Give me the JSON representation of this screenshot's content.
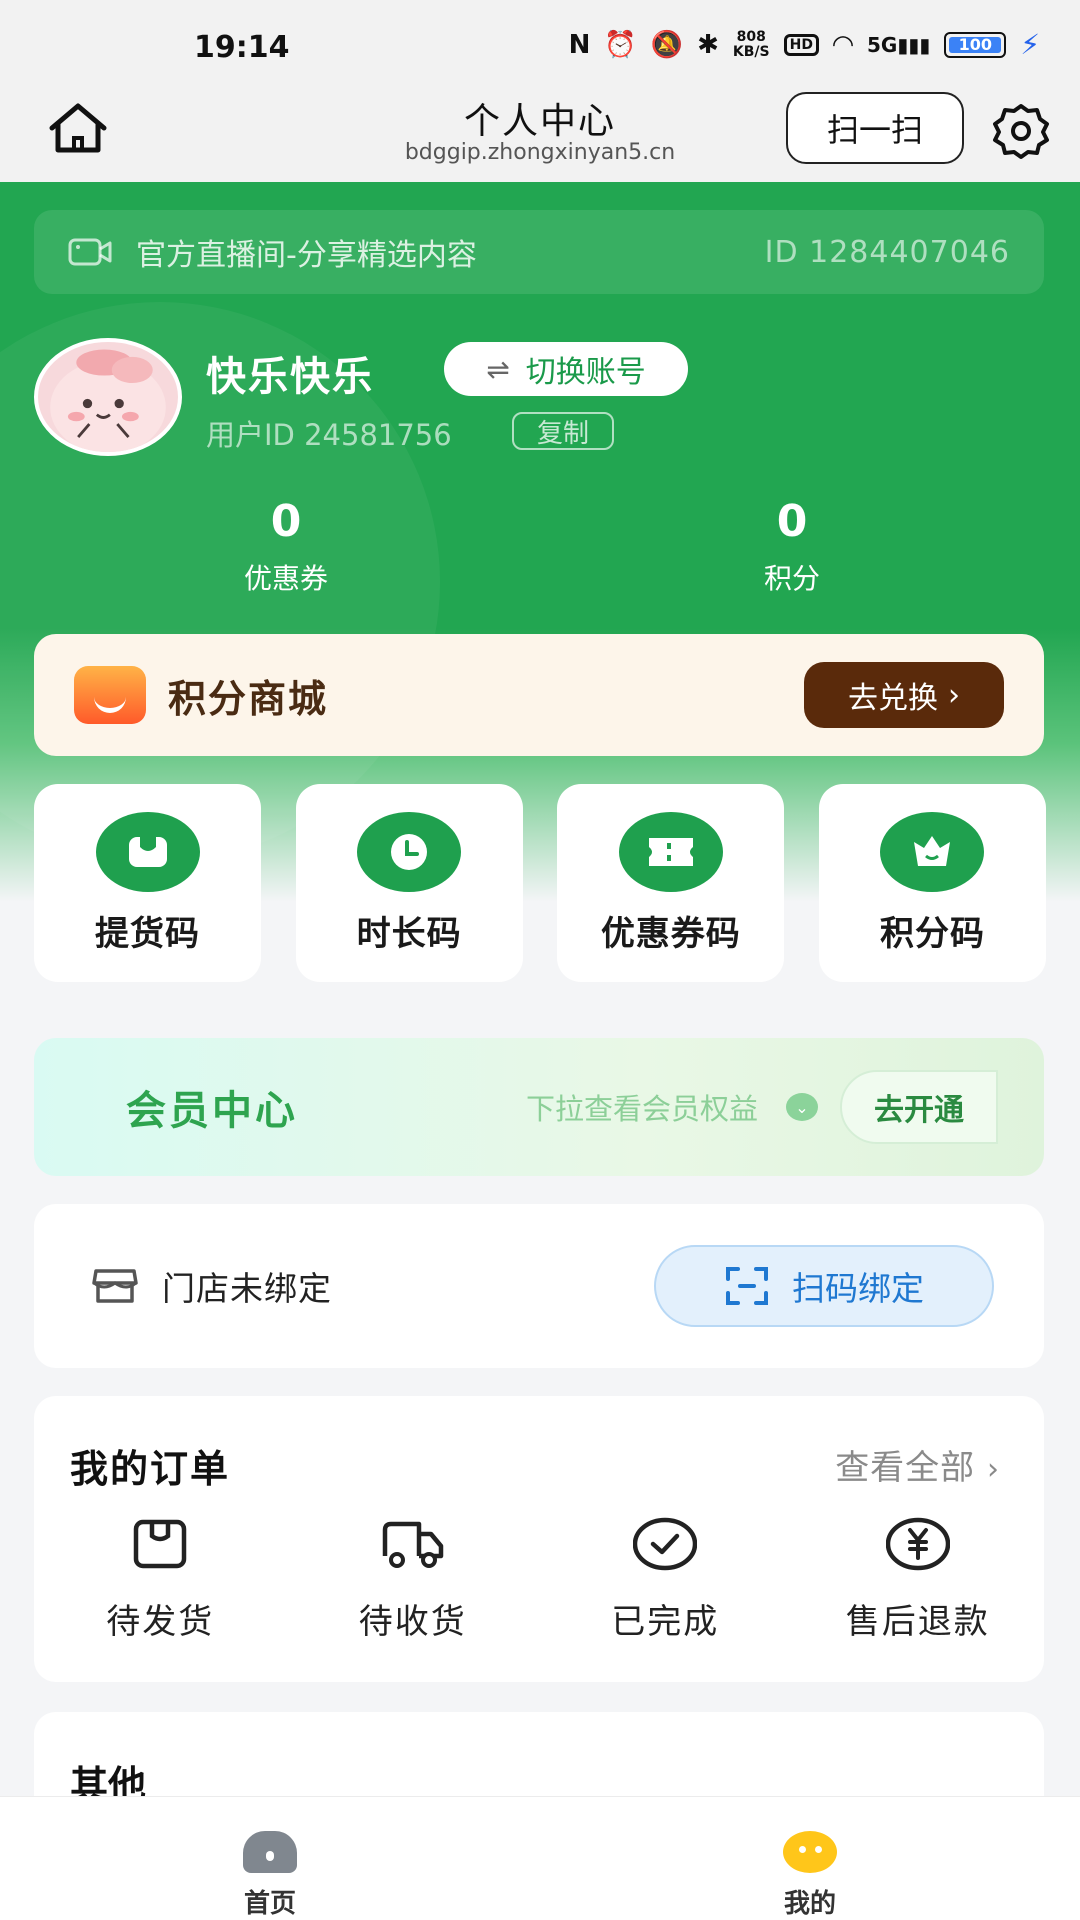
{
  "status_bar": {
    "time": "19:14",
    "speed_value": "808",
    "speed_unit": "KB/S",
    "hd_badge": "HD",
    "network": "5G",
    "battery": "100"
  },
  "header": {
    "title": "个人中心",
    "url": "bdggip.zhongxinyan5.cn",
    "scan_label": "扫一扫"
  },
  "live": {
    "label": "官方直播间-分享精选内容",
    "id": "ID 1284407046"
  },
  "user": {
    "name": "快乐快乐",
    "switch_label": "切换账号",
    "user_id": "用户ID 24581756",
    "copy_label": "复制"
  },
  "stats": [
    {
      "value": "0",
      "label": "优惠券"
    },
    {
      "value": "0",
      "label": "积分"
    }
  ],
  "mall": {
    "title": "积分商城",
    "button": "去兑换"
  },
  "codes": [
    {
      "label": "提货码",
      "icon": "bag-icon"
    },
    {
      "label": "时长码",
      "icon": "clock-icon"
    },
    {
      "label": "优惠券码",
      "icon": "ticket-icon"
    },
    {
      "label": "积分码",
      "icon": "crown-icon"
    }
  ],
  "member": {
    "title": "会员中心",
    "hint": "下拉查看会员权益",
    "button": "去开通"
  },
  "store": {
    "text": "门店未绑定",
    "button": "扫码绑定"
  },
  "orders": {
    "title": "我的订单",
    "view_all": "查看全部",
    "items": [
      {
        "label": "待发货",
        "icon": "package-icon"
      },
      {
        "label": "待收货",
        "icon": "truck-icon"
      },
      {
        "label": "已完成",
        "icon": "check-circle-icon"
      },
      {
        "label": "售后退款",
        "icon": "yen-circle-icon"
      }
    ]
  },
  "other": {
    "title": "其他"
  },
  "bottom_nav": [
    {
      "label": "首页",
      "icon": "home-icon"
    },
    {
      "label": "我的",
      "icon": "profile-icon"
    }
  ],
  "colors": {
    "brand_green": "#22a651",
    "mall_button": "#5a2a0b",
    "store_button_text": "#1f78d1"
  }
}
